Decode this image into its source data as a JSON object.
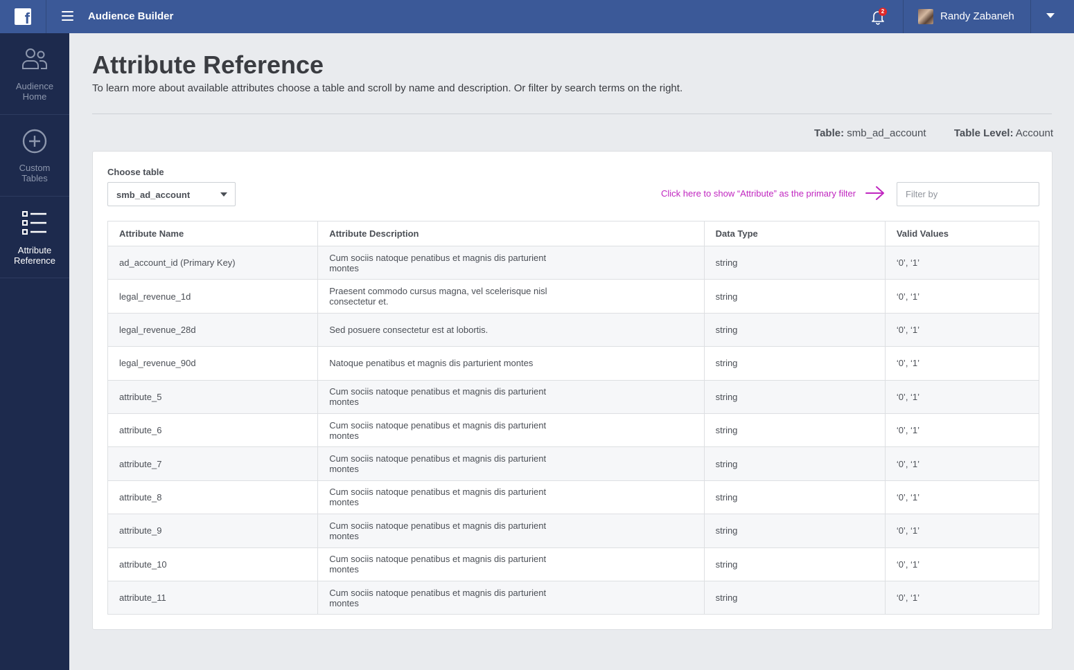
{
  "topbar": {
    "app_title": "Audience Builder",
    "notification_count": "2",
    "user_name": "Randy Zabaneh"
  },
  "sidebar": {
    "items": [
      {
        "label_line1": "Audience",
        "label_line2": "Home",
        "icon": "people-icon"
      },
      {
        "label_line1": "Custom",
        "label_line2": "Tables",
        "icon": "plus-circle-icon"
      },
      {
        "label_line1": "Attribute",
        "label_line2": "Reference",
        "icon": "list-icon",
        "active": true
      }
    ]
  },
  "page": {
    "title": "Attribute Reference",
    "subtitle": "To learn more about available attributes choose a table and scroll by name and description. Or filter by search terms on the right.",
    "table_label": "Table:",
    "table_value": "smb_ad_account",
    "level_label": "Table Level:",
    "level_value": "Account"
  },
  "filter_bar": {
    "choose_label": "Choose table",
    "selected_table": "smb_ad_account",
    "hint": "Click here to show “Attribute” as the primary filter",
    "filter_placeholder": "Filter by"
  },
  "table": {
    "headers": [
      "Attribute Name",
      "Attribute Description",
      "Data Type",
      "Valid Values"
    ],
    "rows": [
      [
        "ad_account_id (Primary Key)",
        "Cum sociis natoque penatibus et magnis dis parturient montes",
        "string",
        "‘0’, ‘1’"
      ],
      [
        "legal_revenue_1d",
        "Praesent commodo cursus magna, vel scelerisque nisl consectetur et.",
        "string",
        "‘0’, ‘1’"
      ],
      [
        "legal_revenue_28d",
        "Sed posuere consectetur est at lobortis.",
        "string",
        "‘0’, ‘1’"
      ],
      [
        "legal_revenue_90d",
        "Natoque penatibus et magnis dis parturient montes",
        "string",
        "‘0’, ‘1’"
      ],
      [
        "attribute_5",
        "Cum sociis natoque penatibus et magnis dis parturient montes",
        "string",
        "‘0’, ‘1’"
      ],
      [
        "attribute_6",
        "Cum sociis natoque penatibus et magnis dis parturient montes",
        "string",
        "‘0’, ‘1’"
      ],
      [
        "attribute_7",
        "Cum sociis natoque penatibus et magnis dis parturient montes",
        "string",
        "‘0’, ‘1’"
      ],
      [
        "attribute_8",
        "Cum sociis natoque penatibus et magnis dis parturient montes",
        "string",
        "‘0’, ‘1’"
      ],
      [
        "attribute_9",
        "Cum sociis natoque penatibus et magnis dis parturient montes",
        "string",
        "‘0’, ‘1’"
      ],
      [
        "attribute_10",
        "Cum sociis natoque penatibus et magnis dis parturient montes",
        "string",
        "‘0’, ‘1’"
      ],
      [
        "attribute_11",
        "Cum sociis natoque penatibus et magnis dis parturient montes",
        "string",
        "‘0’, ‘1’"
      ]
    ]
  },
  "colors": {
    "topbar": "#3b5998",
    "sidebar": "#1d2a4d",
    "hint": "#c026c0",
    "background": "#e9ebee"
  }
}
